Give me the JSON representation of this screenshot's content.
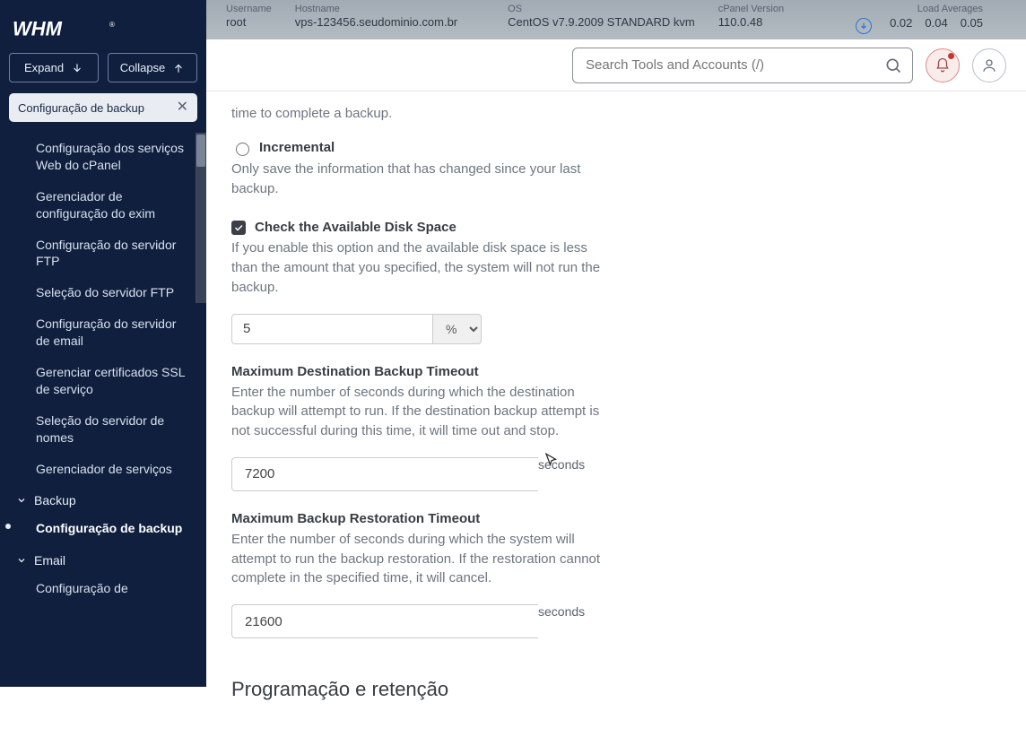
{
  "topbar": {
    "username_label": "Username",
    "username": "root",
    "hostname_label": "Hostname",
    "hostname": "vps-123456.seudominio.com.br",
    "os_label": "OS",
    "os": "CentOS v7.9.2009 STANDARD kvm",
    "cpanel_label": "cPanel Version",
    "cpanel": "110.0.48",
    "load_label": "Load Averages",
    "load1": "0.02",
    "load5": "0.04",
    "load15": "0.05"
  },
  "search": {
    "placeholder": "Search Tools and Accounts (/)"
  },
  "sidebar": {
    "expand": "Expand",
    "collapse": "Collapse",
    "crumb": "Configuração de backup",
    "links": {
      "l0": "Configuração dos serviços Web do cPanel",
      "l1": "Gerenciador de configuração do exim",
      "l2": "Configuração do servidor FTP",
      "l3": "Seleção do servidor FTP",
      "l4": "Configuração do servidor de email",
      "l5": "Gerenciar certificados SSL de serviço",
      "l6": "Seleção do servidor de nomes",
      "l7": "Gerenciador de serviços"
    },
    "sec_backup": "Backup",
    "active": "Configuração de backup",
    "sec_email": "Email",
    "l_email0": "Configuração de"
  },
  "content": {
    "compressed_hint_tail": "time to complete a backup.",
    "incremental_label": "Incremental",
    "incremental_hint": "Only save the information that has changed since your last backup.",
    "check_disk_label": "Check the Available Disk Space",
    "check_disk_hint": "If you enable this option and the available disk space is less than the amount that you specified, the system will not run the backup.",
    "disk_value": "5",
    "disk_unit": "%",
    "dest_timeout_head": "Maximum Destination Backup Timeout",
    "dest_timeout_hint": "Enter the number of seconds during which the destination backup will attempt to run. If the destination backup attempt is not successful during this time, it will time out and stop.",
    "dest_timeout_val": "7200",
    "seconds": "seconds",
    "rest_timeout_head": "Maximum Backup Restoration Timeout",
    "rest_timeout_hint": "Enter the number of seconds during which the system will attempt to run the backup restoration. If the restoration cannot complete in the specified time, it will cancel.",
    "rest_timeout_val": "21600",
    "schedule_head": "Programação e retenção"
  }
}
